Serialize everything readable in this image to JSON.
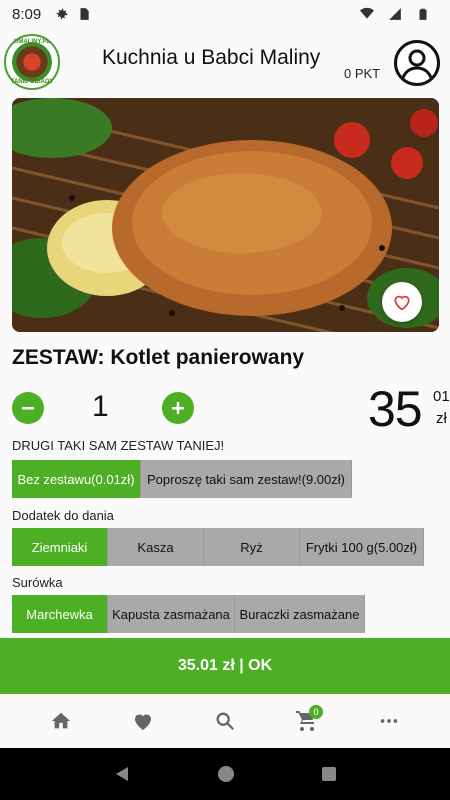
{
  "status_bar": {
    "time": "8:09"
  },
  "header": {
    "logo_text_top": "UMALINY.PL",
    "logo_text_bottom": "TANIE OBIADY",
    "title": "Kuchnia u Babci Maliny",
    "points": "0 PKT"
  },
  "product": {
    "name": "ZESTAW: Kotlet panierowany",
    "quantity": "1",
    "price_main": "35",
    "price_cents": "01",
    "currency": "zł"
  },
  "sections": [
    {
      "label": "DRUGI TAKI SAM ZESTAW TANIEJ!",
      "options": [
        {
          "label": "Bez zestawu(0.01zł)",
          "selected": true
        },
        {
          "label": "Poproszę taki sam zestaw!(9.00zł)",
          "selected": false
        }
      ]
    },
    {
      "label": "Dodatek do dania",
      "options": [
        {
          "label": "Ziemniaki",
          "selected": true
        },
        {
          "label": "Kasza",
          "selected": false
        },
        {
          "label": "Ryż",
          "selected": false
        },
        {
          "label": "Frytki 100 g(5.00zł)",
          "selected": false
        }
      ]
    },
    {
      "label": "Surówka",
      "options": [
        {
          "label": "Marchewka",
          "selected": true
        },
        {
          "label": "Kapusta zasmażana",
          "selected": false
        },
        {
          "label": "Buraczki zasmażane",
          "selected": false
        }
      ]
    }
  ],
  "ok_button": {
    "label": "35.01 zł | OK"
  },
  "bottom_nav": {
    "items": [
      {
        "icon": "home-icon"
      },
      {
        "icon": "heart-icon"
      },
      {
        "icon": "search-icon"
      },
      {
        "icon": "cart-icon",
        "badge": "0"
      },
      {
        "icon": "more-icon"
      }
    ]
  },
  "colors": {
    "accent": "#4caf24",
    "unselected": "#a9a9a9"
  }
}
